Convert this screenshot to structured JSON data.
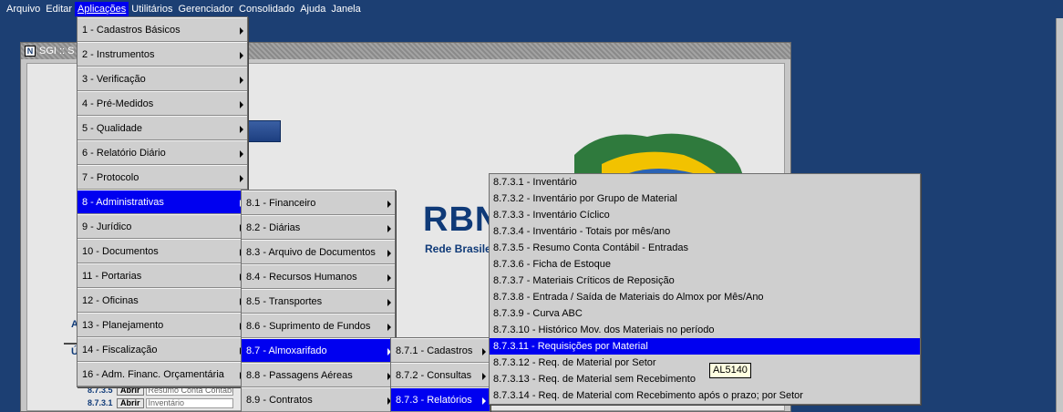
{
  "menubar": {
    "items": [
      "Arquivo",
      "Editar",
      "Aplicações",
      "Utilitários",
      "Gerenciador",
      "Consolidado",
      "Ajuda",
      "Janela"
    ],
    "active_index": 2
  },
  "window": {
    "icon_letter": "N",
    "title": "SGI :: S"
  },
  "background": {
    "logo_text": "RBN",
    "logo_subtitle": "Rede Brasilei",
    "left_label_1": "Ac",
    "left_label_2": "Úl"
  },
  "recent_rows": [
    {
      "code": "8.7.3.5",
      "button": "Abrir",
      "field": "Resumo Conta Contábil"
    },
    {
      "code": "8.7.3.1",
      "button": "Abrir",
      "field": "Inventário"
    }
  ],
  "menu_level1": [
    "1 - Cadastros Básicos",
    "2 - Instrumentos",
    "3 - Verificação",
    "4 - Pré-Medidos",
    "5 - Qualidade",
    "6 - Relatório Diário",
    "7 - Protocolo",
    "8 - Administrativas",
    "9 - Jurídico",
    "10 - Documentos",
    "11 - Portarias",
    "12 - Oficinas",
    "13 - Planejamento",
    "14 - Fiscalização",
    "16 - Adm. Financ. Orçamentária"
  ],
  "menu_level2": [
    "8.1 - Financeiro",
    "8.2 - Diárias",
    "8.3 - Arquivo de Documentos",
    "8.4 - Recursos Humanos",
    "8.5 - Transportes",
    "8.6 - Suprimento de Fundos",
    "8.7 - Almoxarifado",
    "8.8 - Passagens Aéreas",
    "8.9 - Contratos"
  ],
  "menu_level3": [
    "8.7.1 - Cadastros",
    "8.7.2 - Consultas",
    "8.7.3 - Relatórios"
  ],
  "menu_level4": [
    "8.7.3.1 - Inventário",
    "8.7.3.2 - Inventário por Grupo de Material",
    "8.7.3.3 - Inventário Cíclico",
    "8.7.3.4 - Inventário - Totais por mês/ano",
    "8.7.3.5 - Resumo Conta Contábil - Entradas",
    "8.7.3.6 - Ficha de Estoque",
    "8.7.3.7 - Materiais Críticos de Reposição",
    "8.7.3.8 - Entrada / Saída de Materiais do Almox por Mês/Ano",
    "8.7.3.9 - Curva ABC",
    "8.7.3.10 - Histórico Mov. dos Materiais no período",
    "8.7.3.11 - Requisições por Material",
    "8.7.3.12 - Req. de Material por Setor",
    "8.7.3.13 - Req. de Material sem Recebimento",
    "8.7.3.14 - Req. de Material com Recebimento após o prazo; por Setor"
  ],
  "tooltip": "AL5140",
  "colors": {
    "menubar_bg": "#1c3f73",
    "selection": "#0000f0",
    "menu_bg": "#cfcfcf"
  }
}
